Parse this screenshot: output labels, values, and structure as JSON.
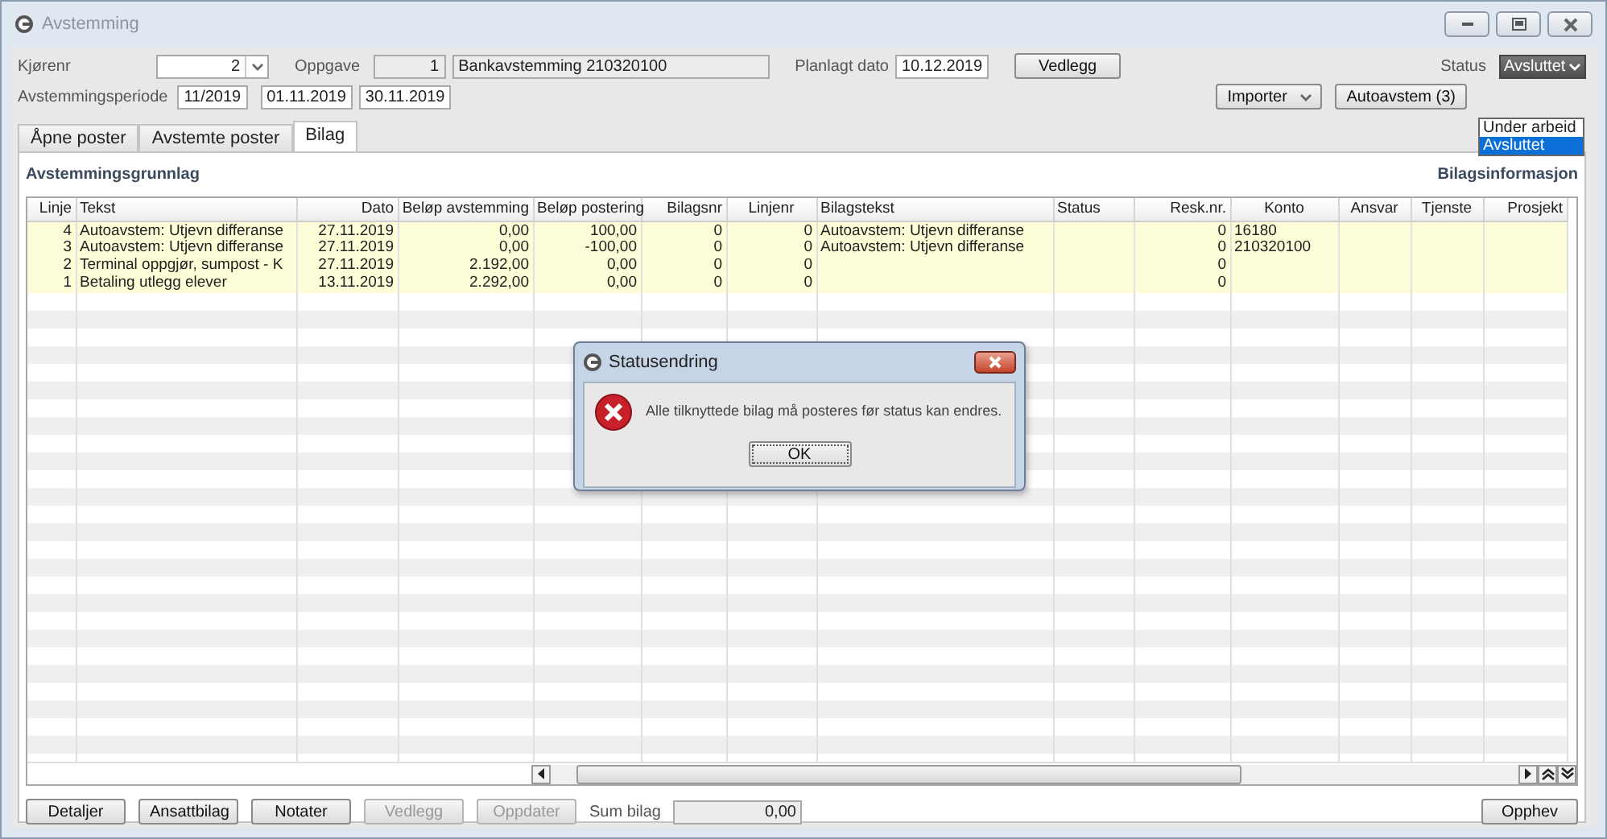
{
  "window": {
    "title": "Avstemming"
  },
  "form": {
    "kjorenr_label": "Kjørenr",
    "kjorenr": "2",
    "oppgave_label": "Oppgave",
    "oppgave_nr": "1",
    "oppgave_text": "Bankavstemming 210320100",
    "planlagt_label": "Planlagt dato",
    "planlagt": "10.12.2019",
    "vedlegg_button": "Vedlegg",
    "periode_label": "Avstemmingsperiode",
    "periode": "11/2019",
    "fra": "01.11.2019",
    "til": "30.11.2019",
    "importer_button": "Importer",
    "autoavstem_button": "Autoavstem (3)",
    "status_label": "Status",
    "status_value": "Avsluttet",
    "status_options": [
      {
        "label": "Under arbeid",
        "selected": false
      },
      {
        "label": "Avsluttet",
        "selected": true
      }
    ]
  },
  "tabs": [
    {
      "label": "Åpne poster",
      "selected": false
    },
    {
      "label": "Avstemte poster",
      "selected": false
    },
    {
      "label": "Bilag",
      "selected": true
    }
  ],
  "panel": {
    "left_title": "Avstemmingsgrunnlag",
    "right_title": "Bilagsinformasjon"
  },
  "table": {
    "columns": [
      "Linje",
      "Tekst",
      "Dato",
      "Beløp avstemming",
      "Beløp postering",
      "Bilagsnr",
      "Linjenr",
      "Bilagstekst",
      "Status",
      "Resk.nr.",
      "Konto",
      "Ansvar",
      "Tjenste",
      "Prosjekt"
    ],
    "rows": [
      [
        "4",
        "Autoavstem: Utjevn differanse",
        "27.11.2019",
        "0,00",
        "100,00",
        "0",
        "0",
        "Autoavstem: Utjevn differanse",
        null,
        "0",
        "16180",
        null,
        null,
        null
      ],
      [
        "3",
        "Autoavstem: Utjevn differanse",
        "27.11.2019",
        "0,00",
        "-100,00",
        "0",
        "0",
        "Autoavstem: Utjevn differanse",
        null,
        "0",
        "210320100",
        null,
        null,
        null
      ],
      [
        "2",
        "Terminal oppgjør, sumpost - K",
        "27.11.2019",
        "2.192,00",
        "0,00",
        "0",
        "0",
        null,
        null,
        "0",
        null,
        null,
        null,
        null
      ],
      [
        "1",
        "Betaling utlegg elever",
        "13.11.2019",
        "2.292,00",
        "0,00",
        "0",
        "0",
        null,
        null,
        "0",
        null,
        null,
        null,
        null
      ]
    ]
  },
  "bottom": {
    "buttons": [
      {
        "label": "Detaljer",
        "disabled": false
      },
      {
        "label": "Ansattbilag",
        "disabled": false
      },
      {
        "label": "Notater",
        "disabled": false
      },
      {
        "label": "Vedlegg",
        "disabled": true
      },
      {
        "label": "Oppdater",
        "disabled": true
      }
    ],
    "sum_label": "Sum bilag",
    "sum_value": "0,00",
    "opphev_button": "Opphev"
  },
  "dialog": {
    "title": "Statusendring",
    "message": "Alle tilknyttede bilag må posteres før status kan endres.",
    "ok_button": "OK"
  }
}
